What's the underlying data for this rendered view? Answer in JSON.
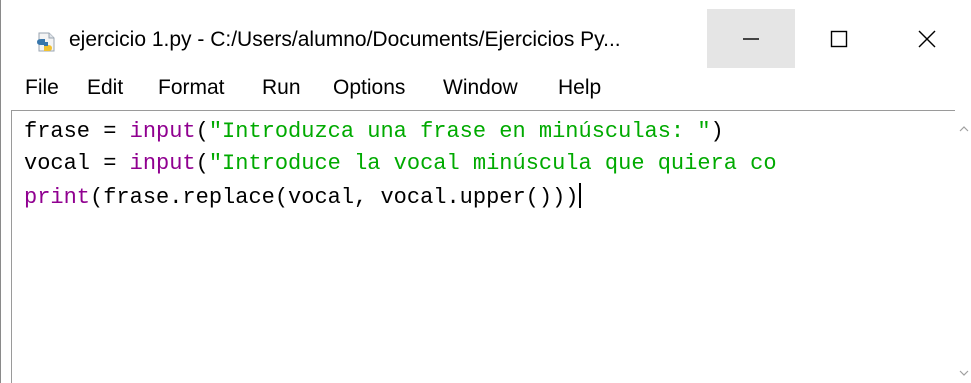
{
  "window": {
    "title": "ejercicio 1.py - C:/Users/alumno/Documents/Ejercicios Py...",
    "app_icon": "python-file-icon",
    "controls": {
      "minimize": "minimize-icon",
      "maximize": "maximize-icon",
      "close": "close-icon"
    }
  },
  "menu": {
    "items": [
      "File",
      "Edit",
      "Format",
      "Run",
      "Options",
      "Window",
      "Help"
    ]
  },
  "editor": {
    "lines": [
      {
        "t1": "frase = ",
        "t2": "input",
        "t3": "(",
        "t4": "\"Introduzca una frase en minúsculas: \"",
        "t5": ")"
      },
      {
        "t1": "vocal = ",
        "t2": "input",
        "t3": "(",
        "t4": "\"Introduce la vocal minúscula que quiera co",
        "t5": ""
      },
      {
        "t1": "print",
        "t2": "(frase.replace(vocal, vocal.upper()))"
      }
    ]
  },
  "colors": {
    "keyword": "#900090",
    "string": "#00aa00",
    "minimize_hover_bg": "#e5e5e5"
  }
}
